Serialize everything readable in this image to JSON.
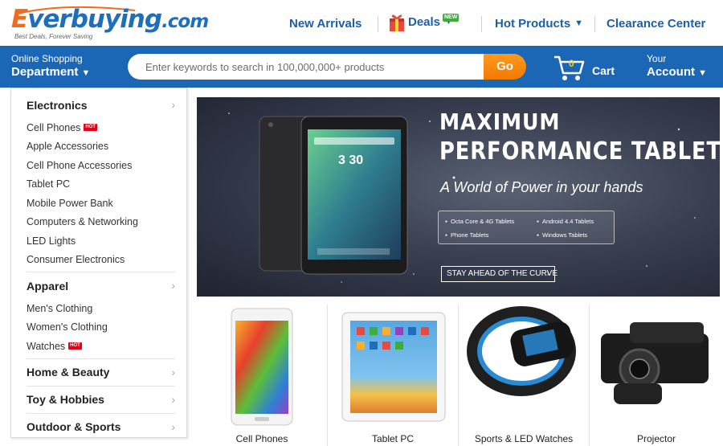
{
  "brand": {
    "logo_first": "E",
    "logo_rest": "verbuying",
    "logo_tld": ".com",
    "tagline": "Best Deals, Forever Saving",
    "colors": {
      "orange": "#f26b1d",
      "blue": "#1d6fbe",
      "bar": "#1c66b6",
      "go": "#f58a0f"
    }
  },
  "topnav": {
    "new_arrivals": "New Arrivals",
    "deals": "Deals",
    "deals_badge": "NEW",
    "hot_products": "Hot Products",
    "clearance": "Clearance Center"
  },
  "bar": {
    "dept_small": "Online Shopping",
    "dept_big": "Department",
    "search_placeholder": "Enter keywords to search in 100,000,000+ products",
    "go": "Go",
    "cart_count": "0",
    "cart_label": "Cart",
    "account_small": "Your",
    "account_big": "Account"
  },
  "menu": {
    "hot_badge": "HOT",
    "electronics": {
      "title": "Electronics",
      "items": [
        "Cell Phones",
        "Apple Accessories",
        "Cell Phone Accessories",
        "Tablet PC",
        "Mobile Power Bank",
        "Computers & Networking",
        "LED Lights",
        "Consumer Electronics"
      ]
    },
    "apparel": {
      "title": "Apparel",
      "items": [
        "Men's Clothing",
        "Women's Clothing",
        "Watches"
      ]
    },
    "home_beauty": "Home & Beauty",
    "toy_hobbies": "Toy & Hobbies",
    "outdoor_sports": "Outdoor & Sports"
  },
  "hero": {
    "title_line1": "MAXIMUM",
    "title_line2": "PERFORMANCE TABLETS",
    "subtitle": "A World of Power in your hands",
    "features": [
      "Octa Core & 4G Tablets",
      "Android 4.4 Tablets",
      "Phone Tablets",
      "Windows Tablets"
    ],
    "cta": "STAY AHEAD OF THE CURVE",
    "tablet_clock": "3 30"
  },
  "tiles": [
    "Cell Phones",
    "Tablet PC",
    "Sports & LED Watches",
    "Projector"
  ]
}
